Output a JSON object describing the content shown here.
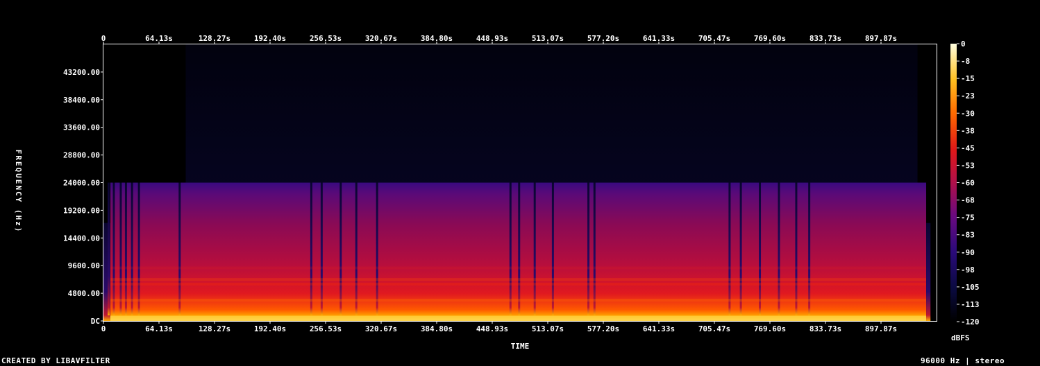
{
  "chart_data": {
    "type": "heatmap",
    "x_axis": {
      "label": "TIME",
      "ticks": [
        "0",
        "64.13s",
        "128.27s",
        "192.40s",
        "256.53s",
        "320.67s",
        "384.80s",
        "448.93s",
        "513.07s",
        "577.20s",
        "641.33s",
        "705.47s",
        "769.60s",
        "833.73s",
        "897.87s"
      ],
      "tick_values": [
        0,
        64.13,
        128.27,
        192.4,
        256.53,
        320.67,
        384.8,
        448.93,
        513.07,
        577.2,
        641.33,
        705.47,
        769.6,
        833.73,
        897.87
      ],
      "range": [
        0,
        962
      ]
    },
    "y_axis": {
      "label": "FREQUENCY (Hz)",
      "ticks": [
        "DC",
        "4800.00",
        "9600.00",
        "14400.00",
        "19200.00",
        "24000.00",
        "28800.00",
        "33600.00",
        "38400.00",
        "43200.00"
      ],
      "tick_values": [
        0,
        4800,
        9600,
        14400,
        19200,
        24000,
        28800,
        33600,
        38400,
        43200
      ],
      "range": [
        0,
        48000
      ]
    },
    "colorbar": {
      "unit": "dBFS",
      "ticks": [
        "0",
        "-8",
        "-15",
        "-23",
        "-30",
        "-38",
        "-45",
        "-53",
        "-60",
        "-68",
        "-75",
        "-83",
        "-90",
        "-98",
        "-105",
        "-113",
        "-120"
      ],
      "range": [
        -120,
        0
      ]
    },
    "content_cutoff_hz": 24000,
    "energy_gaps_s": [
      6,
      12,
      20,
      26,
      33,
      41,
      88,
      240,
      252,
      274,
      292,
      316,
      470,
      480,
      498,
      519,
      560,
      567,
      723,
      736,
      758,
      780,
      800,
      815
    ],
    "grid": false
  },
  "footer": {
    "credit": "CREATED BY LIBAVFILTER",
    "audio_info": "96000 Hz | stereo"
  }
}
